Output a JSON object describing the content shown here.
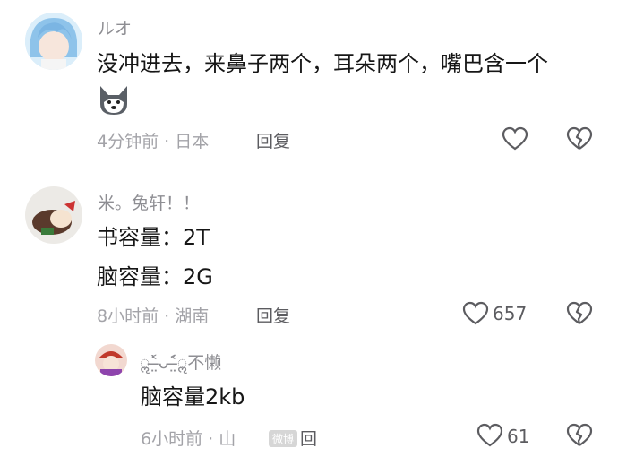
{
  "comments": [
    {
      "username": "ルオ",
      "text": "没冲进去，来鼻子两个，耳朵两个，嘴巴含一个",
      "time_location": "4分钟前 · 日本",
      "reply_label": "回复",
      "like_count": "",
      "emoji": "wolf-dog"
    },
    {
      "username": "米。兔轩！！",
      "text_line1": "书容量：2T",
      "text_line2": "脑容量：2G",
      "time_location": "8小时前 · 湖南",
      "reply_label": "回复",
      "like_count": "657"
    },
    {
      "username": "ॢ˂̶̤̀ᴗ˂̶̤́ॢ不懒",
      "text": "脑容量2kb",
      "time_location": "6小时前 · 山",
      "reply_label": "回",
      "like_count": "61"
    }
  ],
  "watermark": "微博",
  "colors": {
    "text": "#161616",
    "meta": "#a3a3a8",
    "icon": "#5c5c60"
  },
  "icons": [
    "heart-outline",
    "broken-heart-outline"
  ]
}
